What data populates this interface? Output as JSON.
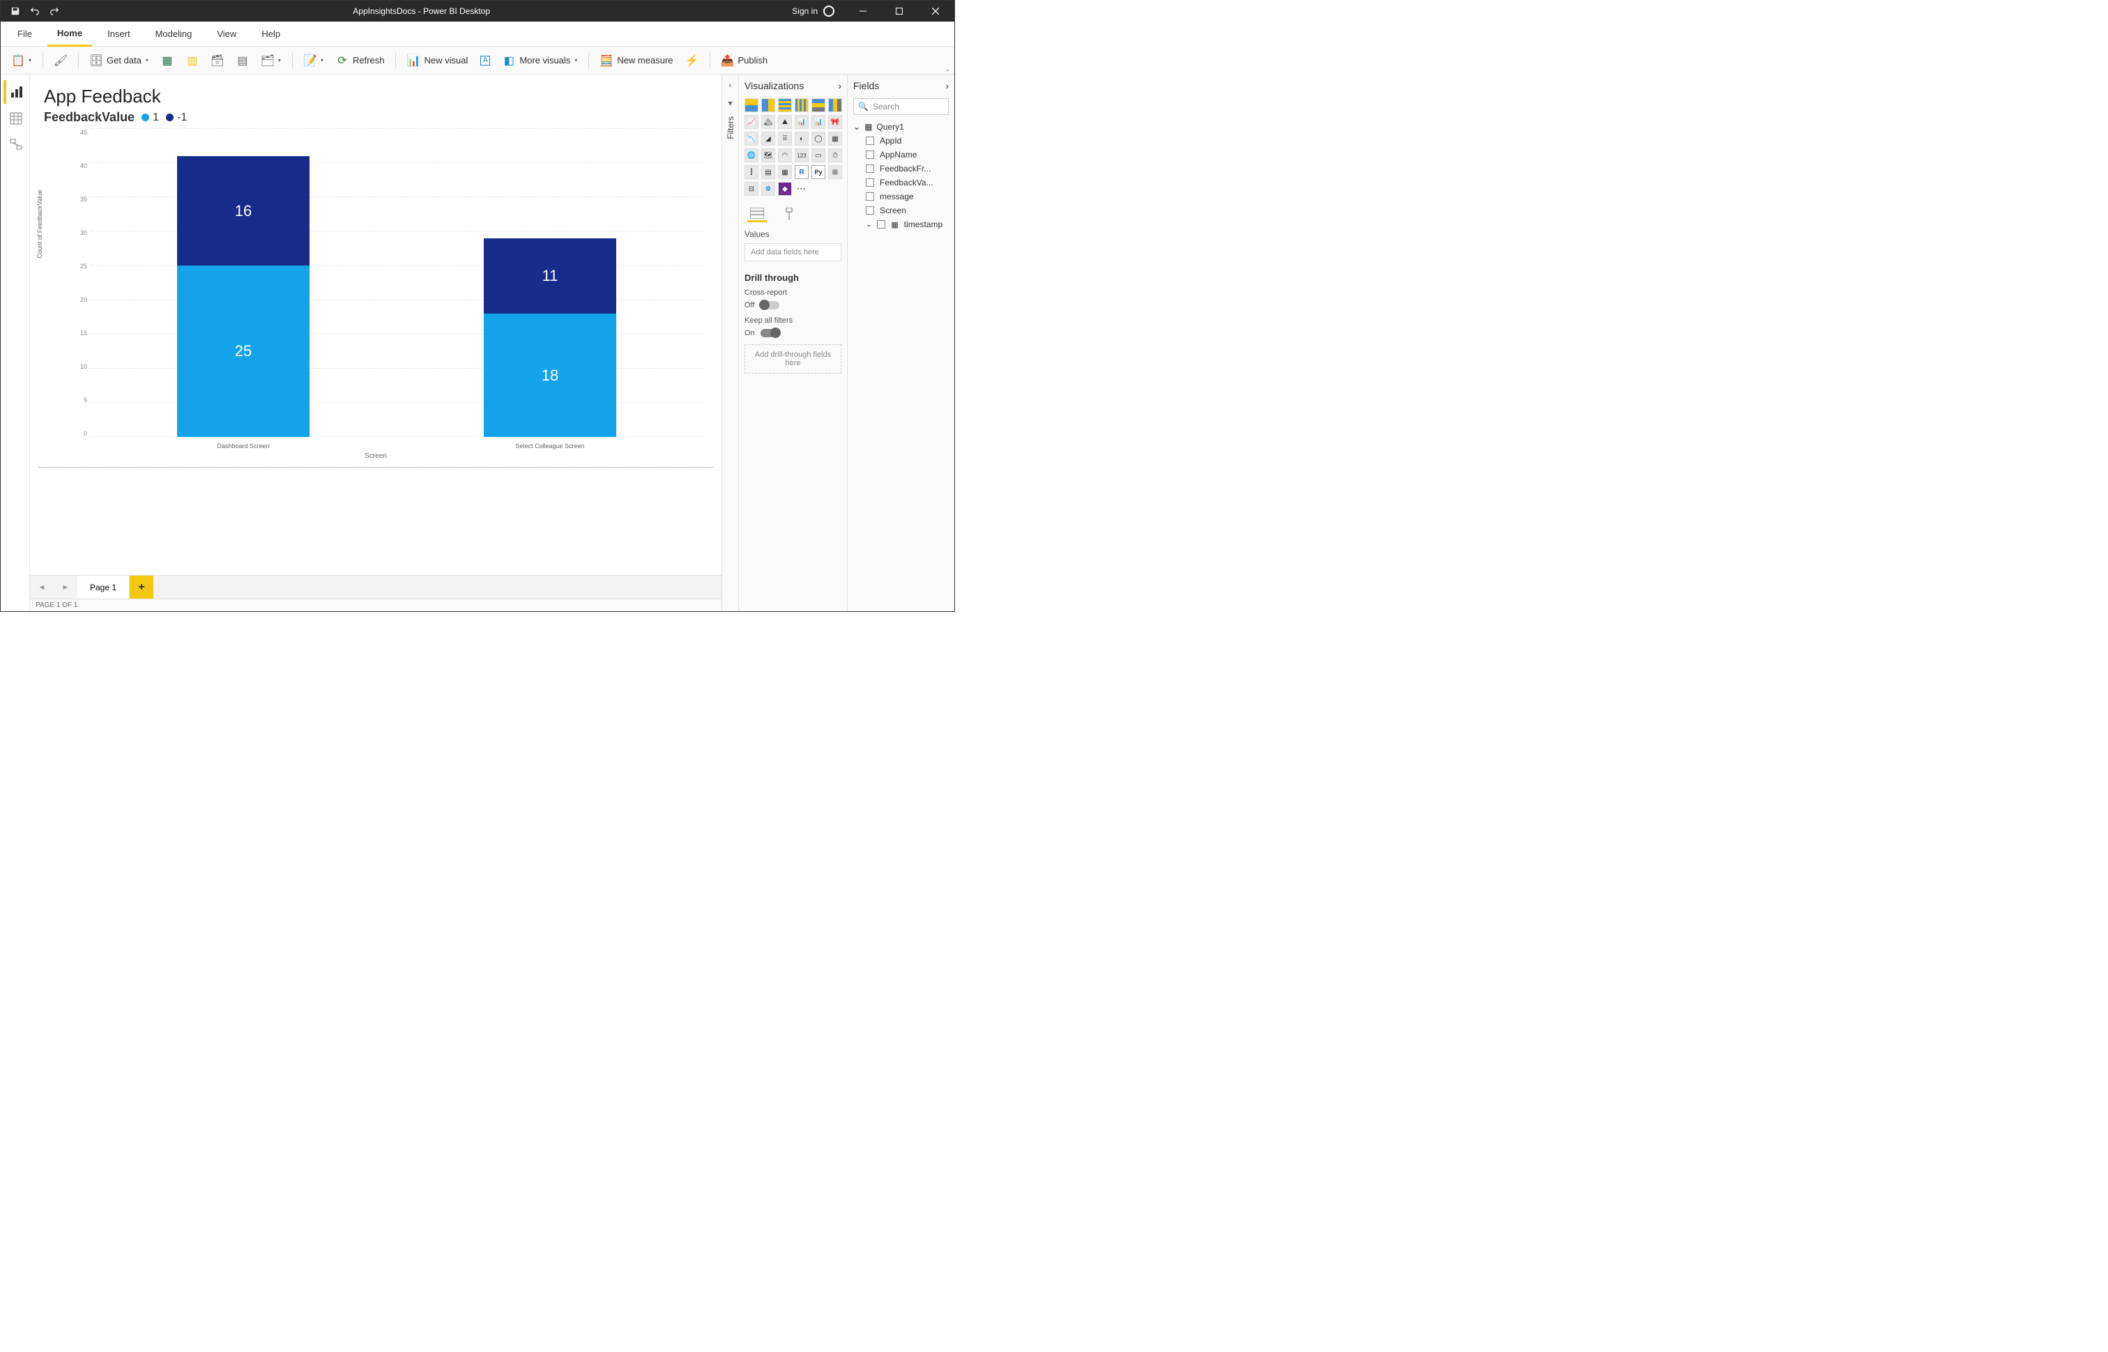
{
  "titlebar": {
    "title": "AppInsightsDocs - Power BI Desktop",
    "sign_in": "Sign in"
  },
  "ribbon_tabs": [
    "File",
    "Home",
    "Insert",
    "Modeling",
    "View",
    "Help"
  ],
  "active_tab_index": 1,
  "ribbon": {
    "get_data": "Get data",
    "refresh": "Refresh",
    "new_visual": "New visual",
    "more_visuals": "More visuals",
    "new_measure": "New measure",
    "publish": "Publish"
  },
  "report": {
    "title": "App Feedback",
    "legend_title": "FeedbackValue",
    "legend": [
      {
        "label": "1",
        "color": "#12a3eb"
      },
      {
        "label": "-1",
        "color": "#172c8a"
      }
    ],
    "y_axis_label": "Count of FeedbackValue",
    "x_axis_label": "Screen"
  },
  "chart_data": {
    "type": "bar",
    "stacked": true,
    "categories": [
      "Dashboard Screen",
      "Select Colleague Screen"
    ],
    "series": [
      {
        "name": "1",
        "color": "#12a3eb",
        "values": [
          25,
          18
        ]
      },
      {
        "name": "-1",
        "color": "#172c8a",
        "values": [
          16,
          11
        ]
      }
    ],
    "ylabel": "Count of FeedbackValue",
    "xlabel": "Screen",
    "ylim": [
      0,
      45
    ],
    "yticks": [
      0,
      5,
      10,
      15,
      20,
      25,
      30,
      35,
      40,
      45
    ]
  },
  "page_tabs": {
    "active": "Page 1"
  },
  "status_bar": "PAGE 1 OF 1",
  "filters_label": "Filters",
  "viz_pane": {
    "title": "Visualizations",
    "values_label": "Values",
    "values_placeholder": "Add data fields here",
    "drill_header": "Drill through",
    "cross_report_label": "Cross-report",
    "cross_report_state": "Off",
    "keep_filters_label": "Keep all filters",
    "keep_filters_state": "On",
    "drill_placeholder": "Add drill-through fields here"
  },
  "fields_pane": {
    "title": "Fields",
    "search_placeholder": "Search",
    "table": "Query1",
    "fields": [
      "AppId",
      "AppName",
      "FeedbackFr...",
      "FeedbackVa...",
      "message",
      "Screen",
      "timestamp"
    ]
  }
}
